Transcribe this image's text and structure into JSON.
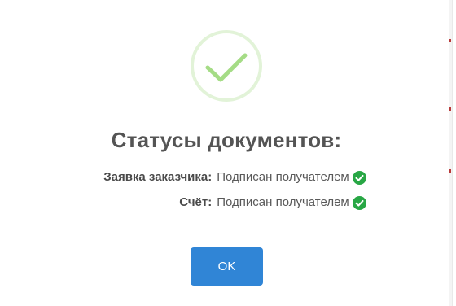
{
  "dialog": {
    "title": "Статусы документов:",
    "statuses": [
      {
        "label": "Заявка заказчика:",
        "value": "Подписан получателем"
      },
      {
        "label": "Счёт:",
        "value": "Подписан получателем"
      }
    ],
    "ok_label": "OK"
  },
  "icons": {
    "success": "success-check-icon",
    "status_check": "check-circle-icon"
  },
  "colors": {
    "success_ring": "#e0f2d5",
    "success_check": "#a5dc86",
    "status_check": "#28a745",
    "button": "#3085d6",
    "text": "#545454"
  }
}
